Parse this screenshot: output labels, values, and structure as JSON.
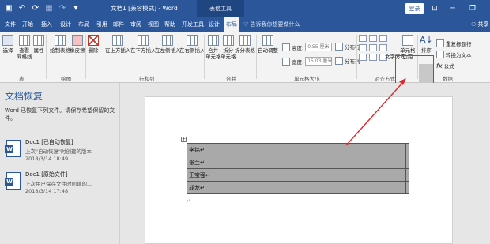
{
  "titlebar": {
    "document_title": "文档1 [兼容模式] - Word",
    "table_tools": "表格工具",
    "login": "登录"
  },
  "tabs": [
    {
      "label": "文件"
    },
    {
      "label": "开始"
    },
    {
      "label": "插入"
    },
    {
      "label": "设计"
    },
    {
      "label": "布局"
    },
    {
      "label": "引用"
    },
    {
      "label": "邮件"
    },
    {
      "label": "审阅"
    },
    {
      "label": "视图"
    },
    {
      "label": "帮助"
    },
    {
      "label": "开发工具"
    },
    {
      "label": "设计"
    },
    {
      "label": "布局"
    }
  ],
  "tell_me": "告诉我你想要做什么",
  "share": "共享",
  "ribbon": {
    "table_group": {
      "select": "选择",
      "gridlines": "查看\n网格线",
      "properties": "属性",
      "label": "表"
    },
    "draw_group": {
      "draw_table": "绘制表格",
      "eraser": "橡皮擦",
      "label": "绘图"
    },
    "rows_cols": {
      "delete": "删除",
      "insert_above": "在上方插入",
      "insert_below": "在下方插入",
      "insert_left": "在左侧插入",
      "insert_right": "在右侧插入",
      "label": "行和列"
    },
    "merge": {
      "merge_cells": "合并\n单元格",
      "split_cells": "拆分\n单元格",
      "split_table": "拆分表格",
      "label": "合并"
    },
    "cell_size": {
      "autofit": "自动调整",
      "height_label": "高度:",
      "height_value": "0.55 厘米",
      "width_label": "宽度:",
      "width_value": "15.03 厘米",
      "distribute_rows": "分布行",
      "distribute_cols": "分布列",
      "label": "单元格大小"
    },
    "alignment": {
      "text_direction": "文字方向",
      "cell_margins": "单元格\n边距",
      "label": "对齐方式"
    },
    "data": {
      "sort": "排序",
      "repeat_header": "重复标题行",
      "convert_text": "转换为文本",
      "formula": "公式",
      "label": "数据"
    }
  },
  "recovery": {
    "title": "文档恢复",
    "description": "Word 已恢复下列文件。请保存希望保留的文件。",
    "items": [
      {
        "name": "Doc1 [已自动恢复]",
        "sub": "上次\"自动恢复\"时创建的版本",
        "time": "2018/3/14 18:49"
      },
      {
        "name": "Doc1 [原始文件]",
        "sub": "上次用户保存文件时创建的...",
        "time": "2018/3/14 17:48"
      }
    ]
  },
  "table_rows": [
    "李铭",
    "张兰",
    "王宝强",
    "成龙"
  ],
  "colors": {
    "word_blue": "#2b579a",
    "highlight_red": "#e3262b",
    "cell_gray": "#a9a9a9"
  }
}
